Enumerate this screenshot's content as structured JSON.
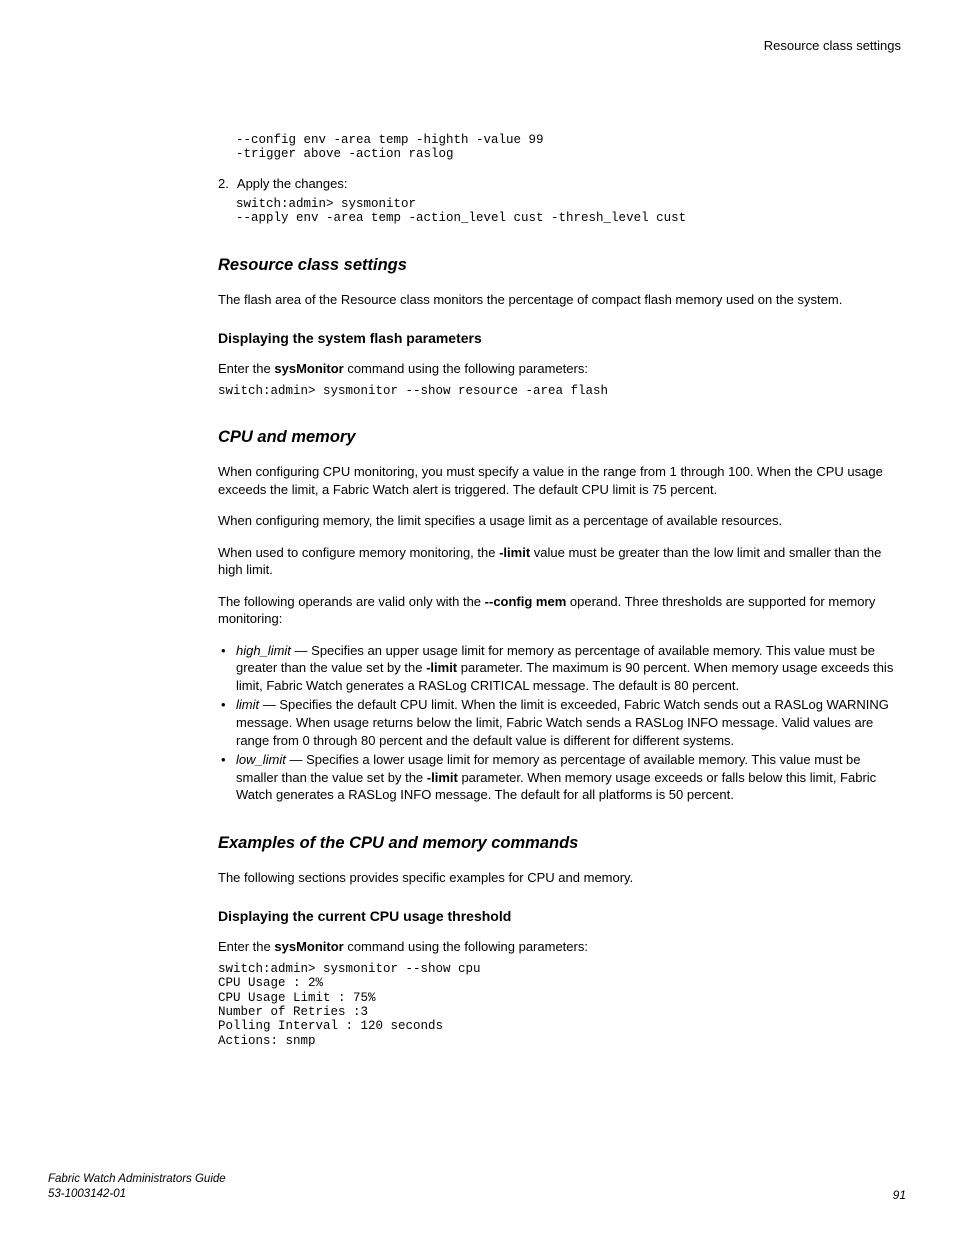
{
  "header": {
    "section_label": "Resource class settings"
  },
  "preblock": {
    "code1": "--config env -area temp -highth -value 99\n-trigger above -action raslog",
    "step2_num": "2.",
    "step2_text": "Apply the changes:",
    "code2": "switch:admin> sysmonitor\n--apply env -area temp -action_level cust -thresh_level cust"
  },
  "resource": {
    "heading": "Resource class settings",
    "para1": "The flash area of the Resource class monitors the percentage of compact flash memory used on the system.",
    "sub_heading": "Displaying the system flash parameters",
    "enter_pre": "Enter the ",
    "enter_cmd": "sysMonitor",
    "enter_post": " command using the following parameters:",
    "code": "switch:admin> sysmonitor --show resource -area flash"
  },
  "cpu": {
    "heading": "CPU and memory",
    "para1": "When configuring CPU monitoring, you must specify a value in the range from 1 through 100. When the CPU usage exceeds the limit, a Fabric Watch alert is triggered. The default CPU limit is 75 percent.",
    "para2": "When configuring memory, the limit specifies a usage limit as a percentage of available resources.",
    "para3_a": "When used to configure memory monitoring, the ",
    "para3_limit": "-limit",
    "para3_b": " value must be greater than the low limit and smaller than the high limit.",
    "para4_a": "The following operands are valid only with the ",
    "para4_cfg": "--config mem",
    "para4_b": " operand. Three thresholds are supported for memory monitoring:",
    "op_high_name": "high_limit",
    "op_high_a": " — Specifies an upper usage limit for memory as percentage of available memory. This value must be greater than the value set by the ",
    "op_high_limit": "-limit",
    "op_high_b": " parameter. The maximum is 90 percent. When memory usage exceeds this limit, Fabric Watch generates a RASLog CRITICAL message. The default is 80 percent.",
    "op_limit_name": "limit",
    "op_limit_text": " — Specifies the default CPU limit. When the limit is exceeded, Fabric Watch sends out a RASLog WARNING message. When usage returns below the limit, Fabric Watch sends a RASLog INFO message. Valid values are range from 0 through 80 percent and the default value is different for different systems.",
    "op_low_name": "low_limit",
    "op_low_a": " — Specifies a lower usage limit for memory as percentage of available memory. This value must be smaller than the value set by the ",
    "op_low_limit": "-limit",
    "op_low_b": " parameter. When memory usage exceeds or falls below this limit, Fabric Watch generates a RASLog INFO message. The default for all platforms is 50 percent."
  },
  "examples": {
    "heading": "Examples of the CPU and memory commands",
    "para1": "The following sections provides specific examples for CPU and memory.",
    "sub_heading": "Displaying the current CPU usage threshold",
    "enter_pre": "Enter the ",
    "enter_cmd": "sysMonitor",
    "enter_post": " command using the following parameters:",
    "code": "switch:admin> sysmonitor --show cpu\nCPU Usage : 2%\nCPU Usage Limit : 75%\nNumber of Retries :3\nPolling Interval : 120 seconds\nActions: snmp"
  },
  "footer": {
    "guide": "Fabric Watch Administrators Guide",
    "docnum": "53-1003142-01",
    "page": "91"
  }
}
